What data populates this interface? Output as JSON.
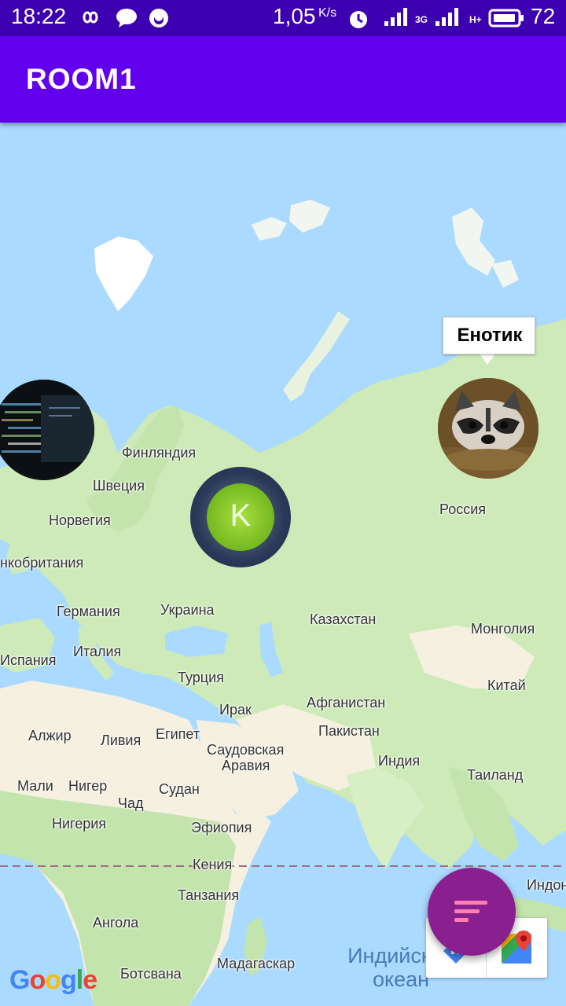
{
  "status_bar": {
    "time": "18:22",
    "speed": "1,05",
    "speed_unit": "K/s",
    "network_3g": "3G",
    "network_h": "H+",
    "battery": "72"
  },
  "app_bar": {
    "title": "ROOM1"
  },
  "map": {
    "country_labels": [
      "Финляндия",
      "Швеция",
      "Норвегия",
      "нкобритания",
      "Германия",
      "Украина",
      "Италия",
      "Испания",
      "Турция",
      "Ирак",
      "Казахстан",
      "Монголия",
      "Китай",
      "Афганистан",
      "Пакистан",
      "Индия",
      "Таиланд",
      "Россия",
      "Саудовская",
      "Аравия",
      "Алжир",
      "Ливия",
      "Египет",
      "Мали",
      "Нигер",
      "Чад",
      "Судан",
      "Нигерия",
      "Эфиопия",
      "Кения",
      "Танзания",
      "Ангола",
      "Мадагаскар",
      "Ботсвана",
      "Индон"
    ],
    "ocean_labels": [
      "Индийский",
      "океан"
    ],
    "markers": {
      "code_user": {
        "avatar": "code-screen-photo"
      },
      "k_user": {
        "initial": "K"
      },
      "raccoon_user": {
        "name": "Енотик",
        "avatar": "raccoon-photo"
      }
    },
    "google_logo": "Google"
  },
  "fab": {
    "icon": "sort-lines-icon"
  },
  "colors": {
    "app_bar": "#6200ee",
    "status_bar": "#3d00b0",
    "fab": "#8a1f8f",
    "ocean": "#aadaff",
    "land": "#cdeab8",
    "desert": "#f5f0e0"
  }
}
